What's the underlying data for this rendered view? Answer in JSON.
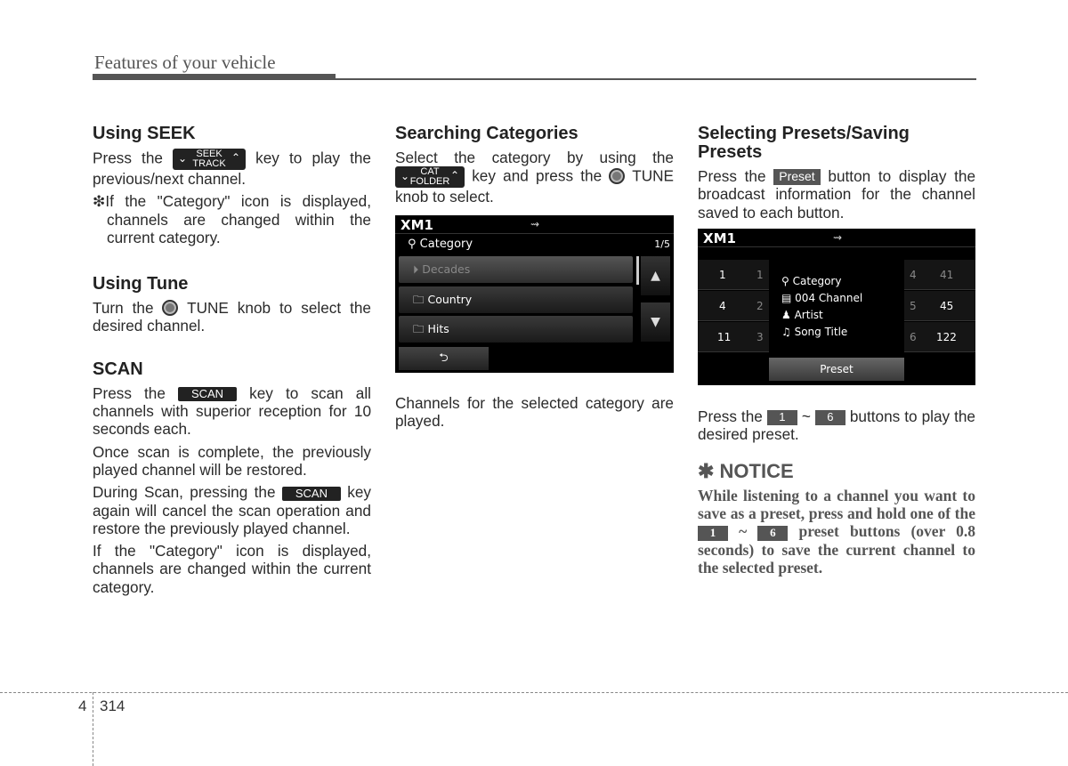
{
  "header": {
    "title": "Features of your vehicle"
  },
  "col1": {
    "seek": {
      "heading": "Using SEEK",
      "p1_before": "Press the",
      "key_top": "SEEK",
      "key_bottom": "TRACK",
      "p1_after": "key to play the previous/next channel.",
      "note": "❇If the \"Category\" icon is displayed, channels are changed within the current category."
    },
    "tune": {
      "heading": "Using Tune",
      "p1_before": "Turn the",
      "p1_after": "TUNE knob to select the desired channel."
    },
    "scan": {
      "heading": "SCAN",
      "key": "SCAN",
      "p1_before": "Press the",
      "p1_after": "key to scan all channels with superior reception for 10 seconds each.",
      "p2": "Once scan is complete, the previously played channel will be restored.",
      "p3_before": "During Scan, pressing the",
      "p3_after": "key again will cancel the scan operation and restore the previously played channel.",
      "p4": "If the \"Category\" icon is displayed, channels are changed within the current category."
    }
  },
  "col2": {
    "heading": "Searching Categories",
    "p1_before": "Select the category by using the",
    "key_top": "CAT",
    "key_bottom": "FOLDER",
    "p1_mid": "key and press the",
    "p1_after": "TUNE knob to select.",
    "screen": {
      "source": "XM1",
      "usb_icon": "⇝",
      "header": "Category",
      "page": "1/5",
      "items": [
        {
          "label": "Decades",
          "icon": "play-circle-icon",
          "glyph": "⏵"
        },
        {
          "label": "Country",
          "icon": "folder-icon",
          "glyph": "🗀"
        },
        {
          "label": "Hits",
          "icon": "folder-icon",
          "glyph": "🗀"
        }
      ],
      "up": "▲",
      "down": "▼",
      "back": "⮌"
    },
    "p2": "Channels for the selected category are played."
  },
  "col3": {
    "heading": "Selecting Presets/Saving Presets",
    "p1_before": "Press the",
    "preset_key": "Preset",
    "p1_after": "button to display the broadcast information for the channel saved to each button.",
    "screen": {
      "source": "XM1",
      "usb_icon": "⇝",
      "left_presets": [
        {
          "num": "1",
          "ch": "1"
        },
        {
          "num": "2",
          "ch": "4"
        },
        {
          "num": "3",
          "ch": "11"
        }
      ],
      "right_presets": [
        {
          "num": "4",
          "ch": "41"
        },
        {
          "num": "5",
          "ch": "45"
        },
        {
          "num": "6",
          "ch": "122"
        }
      ],
      "info": [
        "Category",
        "004 Channel",
        "Artist",
        "Song Title"
      ],
      "preset_button": "Preset"
    },
    "p2_before": "Press the",
    "btn1": "1",
    "tilde": "~",
    "btn6": "6",
    "p2_after": "buttons to play the desired preset.",
    "notice_heading": "✱ NOTICE",
    "notice_before": "While listening to a channel you want to save as a preset, press and hold one of the",
    "notice_after": "preset buttons (over 0.8 seconds) to save the current channel to the selected preset."
  },
  "footer": {
    "chapter": "4",
    "page": "314"
  }
}
